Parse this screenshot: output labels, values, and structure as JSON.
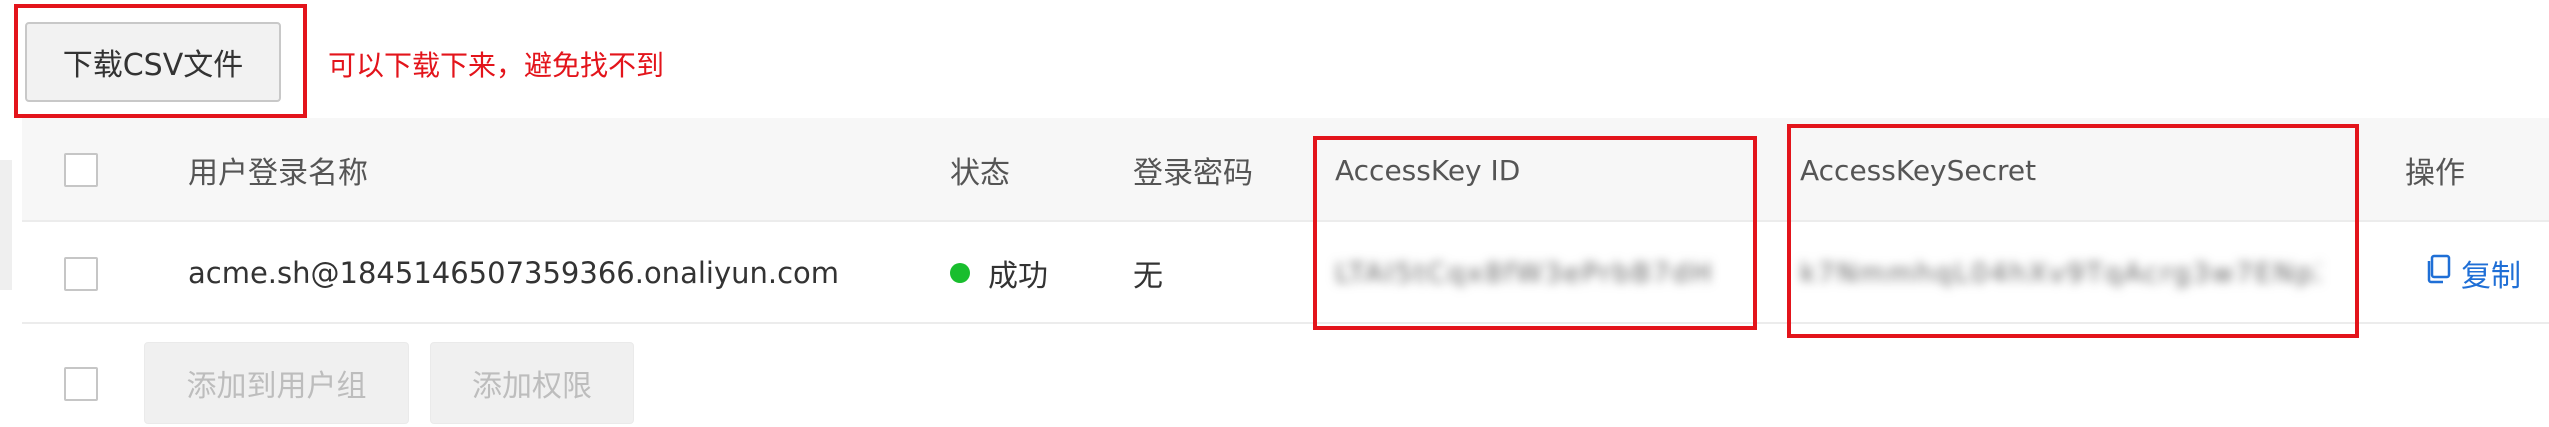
{
  "toolbar": {
    "download_csv_label": "下载CSV文件",
    "annotation_text": "可以下载下来，避免找不到"
  },
  "table": {
    "columns": {
      "username": "用户登录名称",
      "status": "状态",
      "login_password": "登录密码",
      "access_key_id": "AccessKey ID",
      "access_key_secret": "AccessKeySecret",
      "actions": "操作"
    },
    "row": {
      "username": "acme.sh@1845146507359366.onaliyun.com",
      "status": "成功",
      "login_password": "无",
      "access_key_id": "LTAI5tCqx8fW3ePrbB7dHu1t",
      "access_key_secret": "k7NmmhqL04hXv9TqAcrg3w7ENpXtTfzf",
      "copy_label": "复制"
    }
  },
  "footer": {
    "add_to_group_label": "添加到用户组",
    "add_permission_label": "添加权限"
  },
  "colors": {
    "annotation_red": "#e3141b",
    "status_success": "#19be2e",
    "link_blue": "#1f6fd6",
    "disabled_text": "#bdbdbd"
  },
  "icons": {
    "copy": "copy-icon",
    "status": "status-dot-icon"
  }
}
